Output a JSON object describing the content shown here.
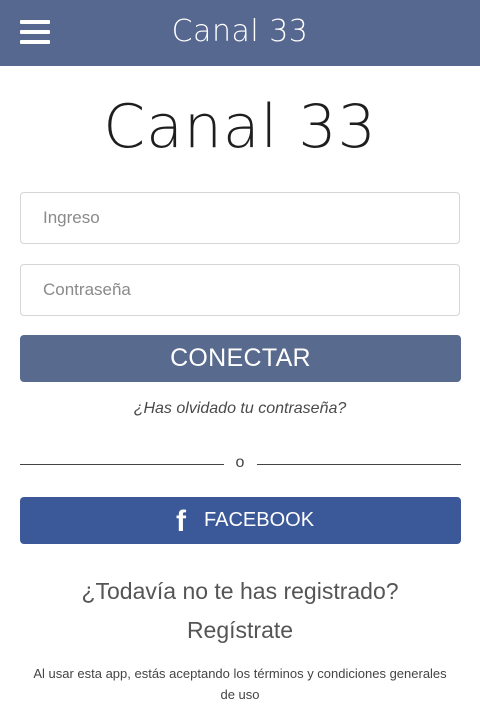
{
  "header": {
    "title": "Canal 33",
    "menu_icon": "hamburger-menu-icon"
  },
  "logo": {
    "title": "Canal 33"
  },
  "login_form": {
    "username_placeholder": "Ingreso",
    "username_value": "",
    "password_placeholder": "Contraseña",
    "password_value": "",
    "connect_label": "CONECTAR",
    "forgot_password": "¿Has olvidado tu contraseña?"
  },
  "divider": {
    "text": "o"
  },
  "facebook": {
    "icon": "facebook-f-icon",
    "icon_glyph": "f",
    "label": "FACEBOOK"
  },
  "register": {
    "prompt": "¿Todavía no te has registrado?",
    "link": "Regístrate"
  },
  "terms": {
    "text": "Al usar esta app, estás aceptando los términos y condiciones generales de uso"
  },
  "colors": {
    "header_bg": "#56688f",
    "connect_bg": "#586a8e",
    "facebook_bg": "#3b5998"
  }
}
